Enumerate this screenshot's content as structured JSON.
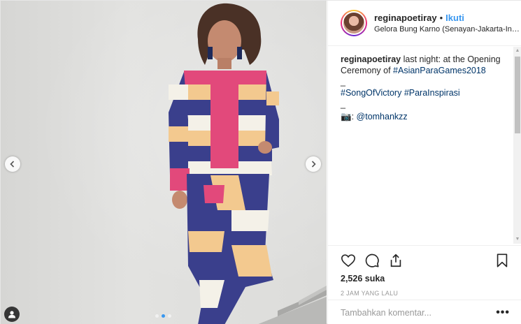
{
  "post": {
    "image_alt": "Photo of woman in colorful striped outfit",
    "carousel": {
      "count": 3,
      "active": 1
    },
    "icons": {
      "prev": "chevron-left-icon",
      "next": "chevron-right-icon",
      "tag": "user-tag-icon"
    }
  },
  "header": {
    "username": "reginapoetiray",
    "separator": "•",
    "follow_label": "Ikuti",
    "location": "Gelora Bung Karno (Senayan-Jakarta-Indo..."
  },
  "caption": {
    "username": "reginapoetiray",
    "text1": " last night: at the Opening Ceremony of ",
    "hashtag1": "#AsianParaGames2018",
    "dash1": "_",
    "hashtag2": "#SongOfVictory",
    "space": " ",
    "hashtag3": "#ParaInspirasi",
    "dash2": "_",
    "camera_icon": "📷",
    "credit_prefix": ": ",
    "credit": "@tomhankzz"
  },
  "actions": {
    "icons": [
      "heart-icon",
      "comment-icon",
      "share-icon",
      "bookmark-icon"
    ],
    "likes": "2,526 suka",
    "time": "2 JAM YANG LALU"
  },
  "comment_box": {
    "placeholder": "Tambahkan komentar...",
    "more": "•••"
  },
  "colors": {
    "link": "#003569",
    "accent": "#3897f0"
  }
}
